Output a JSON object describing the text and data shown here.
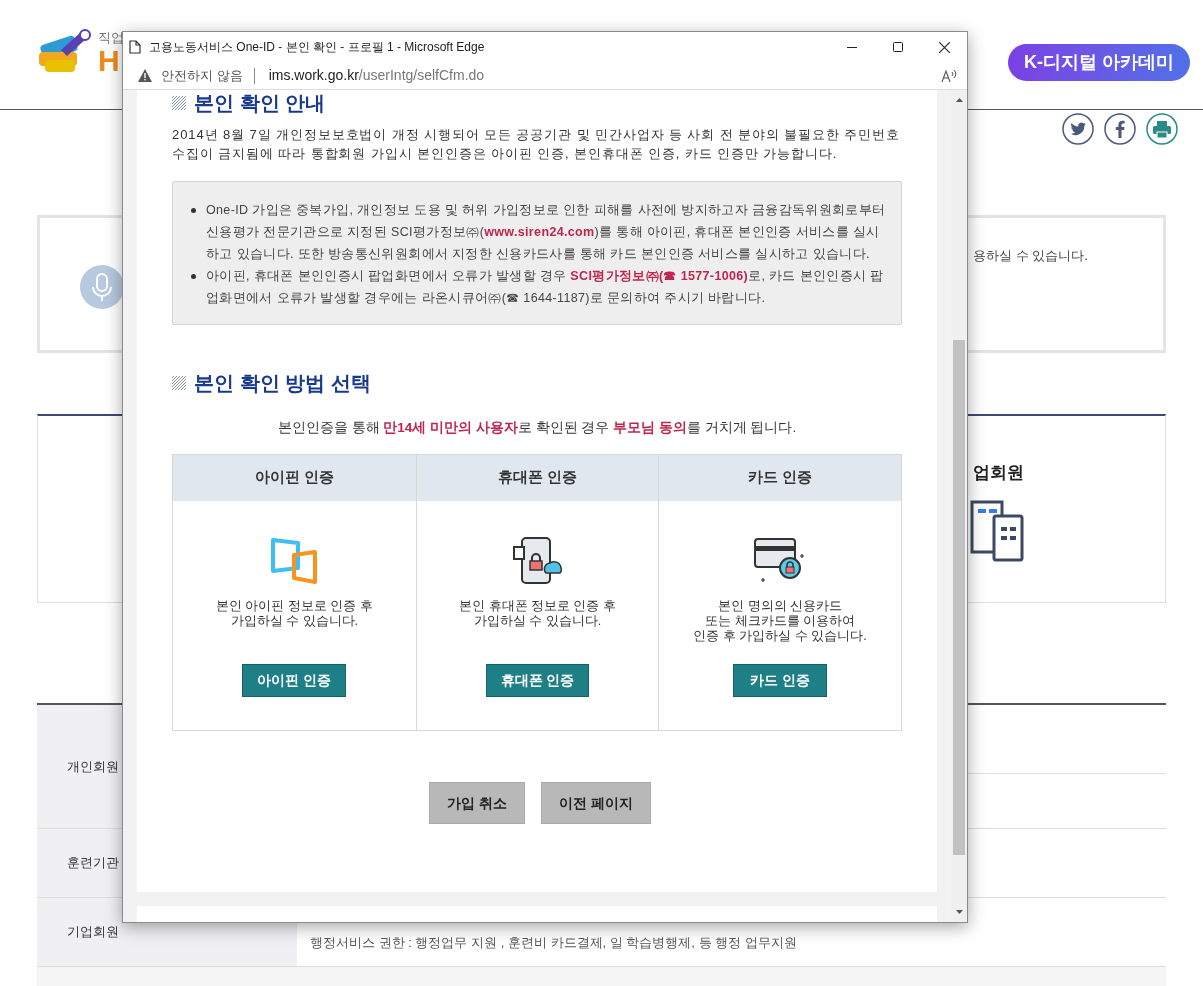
{
  "background_page": {
    "logo": {
      "caption": "직업",
      "letter": "H"
    },
    "academy_button": "K-디지털 아카데미",
    "notice_text": "용하실 수 있습니다.",
    "member_heading": "업회원",
    "member_table": [
      {
        "label": "개인회원"
      },
      {
        "label": "훈련기관"
      },
      {
        "label": "기업회원",
        "lines": [
          "행정서비스 권한 : 행정업무 지원 , 훈련비 카드결제, 일 학습병행제, 등 행정 업무지원"
        ]
      }
    ]
  },
  "popup": {
    "title": "고용노동서비스 One-ID - 본인 확인 - 프로필 1 - Microsoft Edge",
    "security": "안전하지 않음",
    "url_host": "ims.work.go.kr",
    "url_path": "/userIntg/selfCfm.do",
    "guide_heading": "본인 확인 안내",
    "guide_text": "2014년 8월 7일 개인정보보호법이 개정 시행되어 모든 공공기관 및 민간사업자 등 사회 전 분야의 불필요한 주민번호 수집이 금지됨에 따라 통합회원 가입시 본인인증은 아이핀 인증, 본인휴대폰 인증, 카드 인증만 가능합니다.",
    "notes": [
      {
        "parts": [
          {
            "kind": "text",
            "text": "One-ID 가입은 중복가입, 개인정보 도용 및 허위 가입정보로 인한 피해를 사전에 방지하고자 금융감독위원회로부터 신용평가 전문기관으로 지정된 SCI평가정보㈜("
          },
          {
            "kind": "link",
            "text": "www.siren24.com"
          },
          {
            "kind": "text",
            "text": ")를 통해 아이핀, 휴대폰 본인인증 서비스를 실시하고 있습니다. 또한 방송통신위원회에서 지정한 신용카드사를 통해 카드 본인인증 서비스를 실시하고 있습니다."
          }
        ]
      },
      {
        "parts": [
          {
            "kind": "text",
            "text": "아이핀, 휴대폰 본인인증시 팝업화면에서 오류가 발생할 경우 **SCI평가정보㈜(☎ 1577-1006)**로, 카드 본인인증시 팝업화면에서 오류가 발생할 경우에는 라온시큐어㈜(☎ 1644-1187)로 문의하여 주시기 바랍니다."
          }
        ]
      }
    ],
    "method_heading": "본인 확인 방법 선택",
    "method_notice": "본인인증을 통해 **만14세 미만의 사용자**로 확인된 경우 **부모님 동의**를 거치게 됩니다.",
    "methods": [
      {
        "kind": "ipin",
        "title": "아이핀 인증",
        "description": "본인 아이핀 정보로 인증 후\n가입하실 수 있습니다.",
        "button": "아이핀 인증"
      },
      {
        "kind": "phone",
        "title": "휴대폰 인증",
        "description": "본인 휴대폰 정보로 인증 후\n가입하실 수 있습니다.",
        "button": "휴대폰 인증"
      },
      {
        "kind": "card",
        "title": "카드 인증",
        "description": "본인 명의의 신용카드\n또는 체크카드를 이용하여\n인증 후 가입하실 수 있습니다.",
        "button": "카드 인증"
      }
    ],
    "buttons": [
      "가입 취소",
      "이전 페이지"
    ]
  }
}
